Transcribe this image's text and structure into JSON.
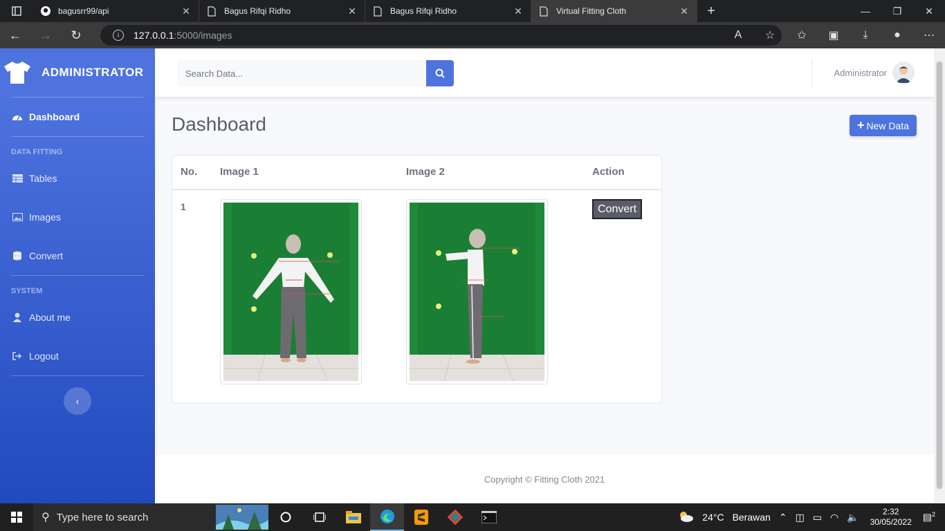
{
  "browser": {
    "tabs": [
      {
        "title": "bagusrr99/api",
        "icon": "github-icon"
      },
      {
        "title": "Bagus Rifqi Ridho",
        "icon": "page-icon"
      },
      {
        "title": "Bagus Rifqi Ridho",
        "icon": "page-icon"
      },
      {
        "title": "Virtual Fitting Cloth",
        "icon": "page-icon",
        "active": true
      }
    ],
    "url_host": "127.0.0.1",
    "url_path": ":5000/images"
  },
  "sidebar": {
    "brand": "ADMINISTRATOR",
    "dashboard": "Dashboard",
    "section_data": "DATA FITTING",
    "tables": "Tables",
    "images": "Images",
    "convert": "Convert",
    "section_system": "SYSTEM",
    "about": "About me",
    "logout": "Logout"
  },
  "topbar": {
    "search_placeholder": "Search Data...",
    "user_name": "Administrator"
  },
  "main": {
    "title": "Dashboard",
    "new_button": "New Data",
    "table": {
      "headers": [
        "No.",
        "Image 1",
        "Image 2",
        "Action"
      ],
      "rows": [
        {
          "no": "1",
          "action": "Convert"
        }
      ]
    }
  },
  "footer": "Copyright © Fitting Cloth 2021",
  "taskbar": {
    "search": "Type here to search",
    "weather_temp": "24°C",
    "weather_desc": "Berawan",
    "time": "2:32",
    "date": "30/05/2022",
    "notifications": "2"
  },
  "colors": {
    "primary": "#4e73df",
    "sidebar_end": "#224abe"
  }
}
